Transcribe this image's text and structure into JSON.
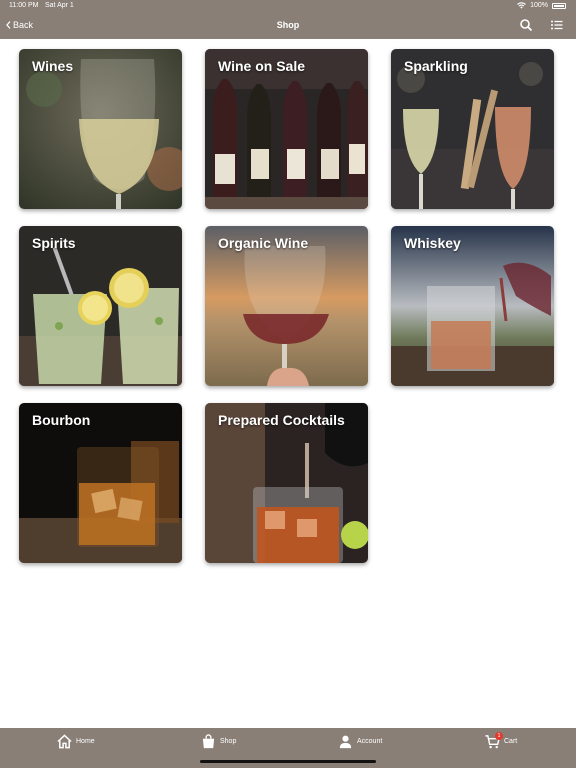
{
  "status_bar": {
    "time": "11:00 PM",
    "date": "Sat Apr 1",
    "battery": "100%"
  },
  "nav": {
    "back_label": "Back",
    "title": "Shop"
  },
  "categories": [
    {
      "label": "Wines"
    },
    {
      "label": "Wine on Sale"
    },
    {
      "label": "Sparkling"
    },
    {
      "label": "Spirits"
    },
    {
      "label": "Organic Wine"
    },
    {
      "label": "Whiskey"
    },
    {
      "label": "Bourbon"
    },
    {
      "label": "Prepared Cocktails"
    }
  ],
  "tabs": [
    {
      "label": "Home",
      "icon": "home-icon"
    },
    {
      "label": "Shop",
      "icon": "shopping-bag-icon"
    },
    {
      "label": "Account",
      "icon": "person-icon"
    },
    {
      "label": "Cart",
      "icon": "cart-icon",
      "badge": "1"
    }
  ],
  "colors": {
    "bar": "#8a7f77",
    "badge": "#e23b2e"
  }
}
